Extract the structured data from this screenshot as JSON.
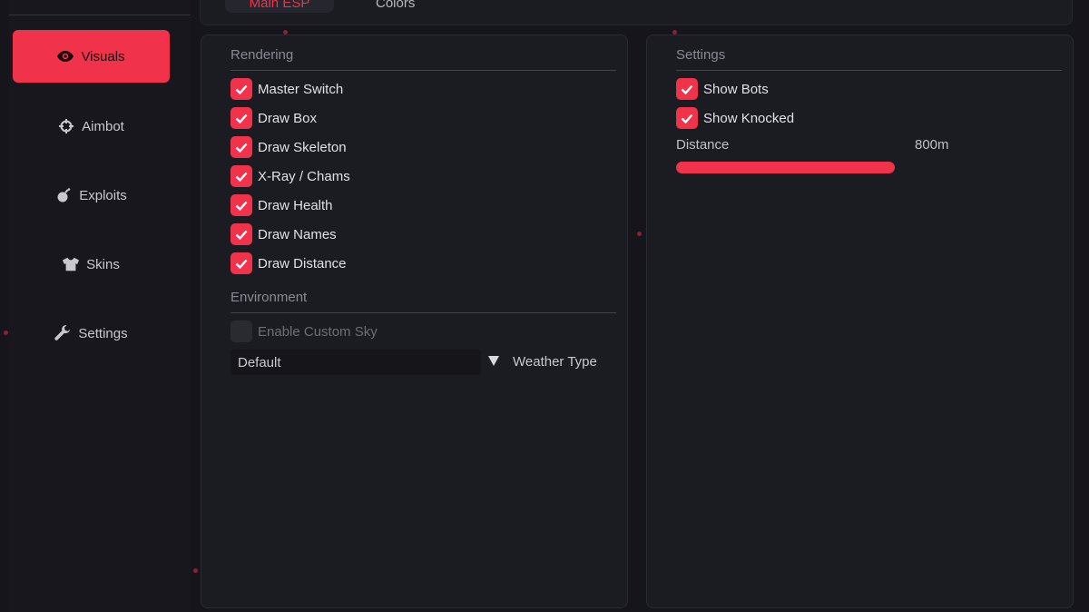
{
  "sidebar": {
    "items": [
      {
        "label": "Visuals",
        "icon": "eye-icon",
        "active": true
      },
      {
        "label": "Aimbot",
        "icon": "crosshair-icon",
        "active": false
      },
      {
        "label": "Exploits",
        "icon": "bomb-icon",
        "active": false
      },
      {
        "label": "Skins",
        "icon": "shirt-icon",
        "active": false
      },
      {
        "label": "Settings",
        "icon": "wrench-icon",
        "active": false
      }
    ]
  },
  "tabs": [
    {
      "label": "Main ESP",
      "active": true
    },
    {
      "label": "Colors",
      "active": false
    }
  ],
  "left_panel": {
    "rendering_title": "Rendering",
    "rendering_items": [
      {
        "label": "Master Switch",
        "checked": true
      },
      {
        "label": "Draw Box",
        "checked": true
      },
      {
        "label": "Draw Skeleton",
        "checked": true
      },
      {
        "label": "X-Ray / Chams",
        "checked": true
      },
      {
        "label": "Draw Health",
        "checked": true
      },
      {
        "label": "Draw Names",
        "checked": true
      },
      {
        "label": "Draw Distance",
        "checked": true
      }
    ],
    "environment_title": "Environment",
    "custom_sky": {
      "label": "Enable Custom Sky",
      "checked": false
    },
    "weather": {
      "value": "Default",
      "label": "Weather Type"
    }
  },
  "right_panel": {
    "settings_title": "Settings",
    "items": [
      {
        "label": "Show Bots",
        "checked": true
      },
      {
        "label": "Show Knocked",
        "checked": true
      }
    ],
    "distance": {
      "label": "Distance",
      "value_text": "800m",
      "fraction": 0.8
    }
  },
  "colors": {
    "accent": "#f0334a",
    "background": "#15151b",
    "panel": "#1b1b22"
  }
}
